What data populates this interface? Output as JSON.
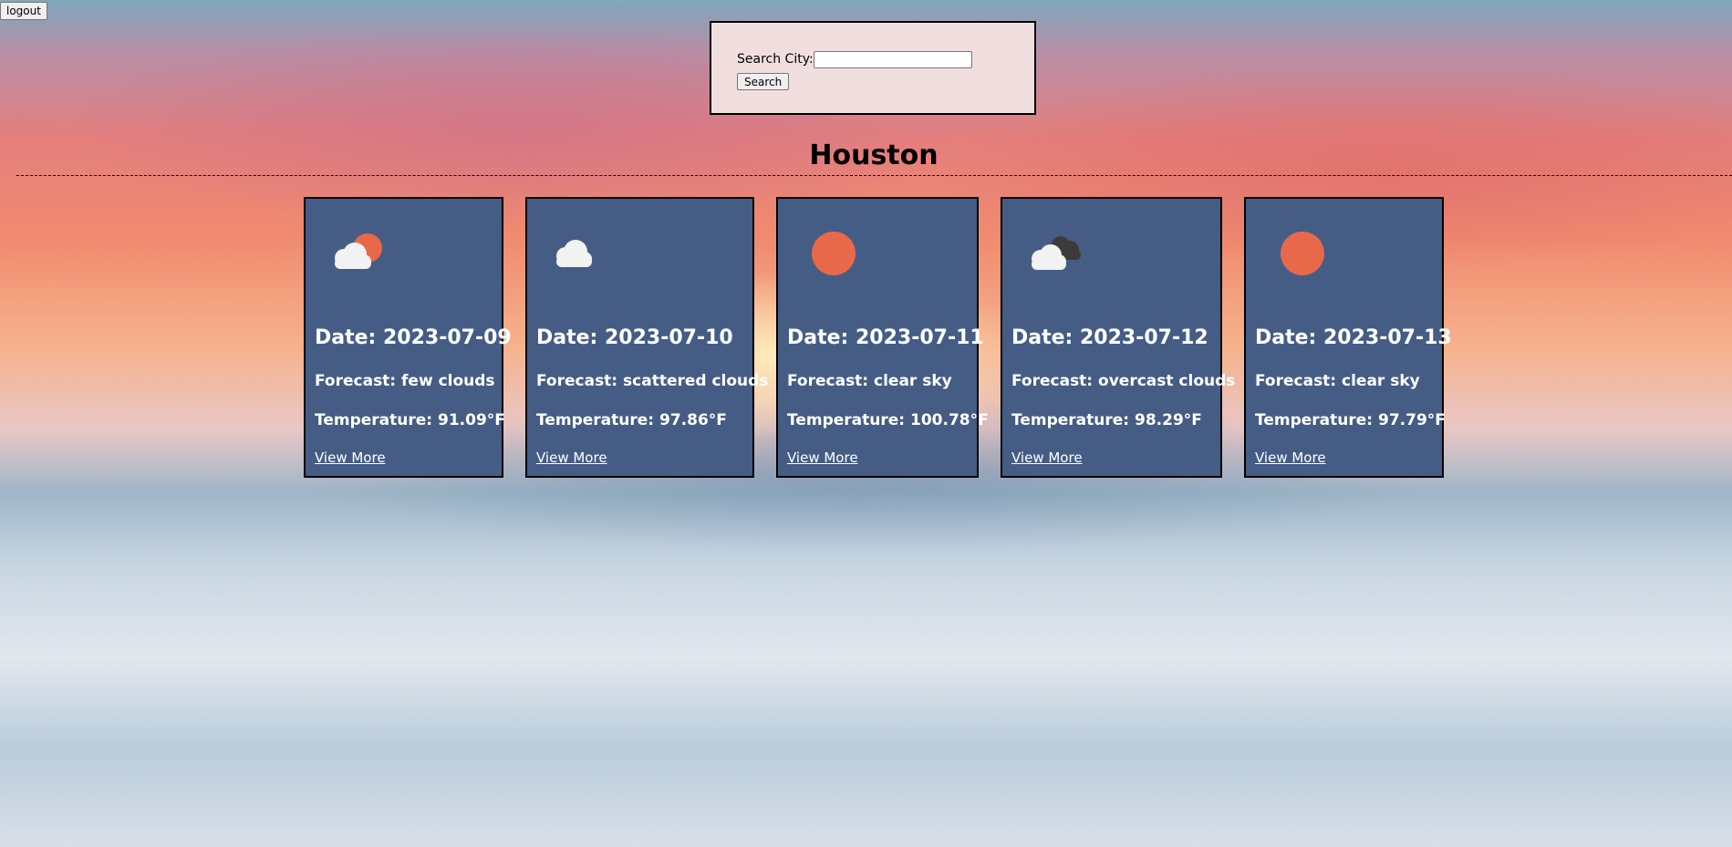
{
  "header": {
    "logout_label": "logout"
  },
  "search": {
    "label": "Search City:",
    "value": "",
    "placeholder": "",
    "button_label": "Search"
  },
  "city": "Houston",
  "forecasts": [
    {
      "date": "Date: 2023-07-09",
      "forecast": "Forecast: few clouds",
      "temperature": "Temperature: 91.09°F",
      "link": "View More",
      "icon": "few-clouds-icon"
    },
    {
      "date": "Date: 2023-07-10",
      "forecast": "Forecast: scattered clouds",
      "temperature": "Temperature: 97.86°F",
      "link": "View More",
      "icon": "scattered-clouds-icon"
    },
    {
      "date": "Date: 2023-07-11",
      "forecast": "Forecast: clear sky",
      "temperature": "Temperature: 100.78°F",
      "link": "View More",
      "icon": "clear-sky-icon"
    },
    {
      "date": "Date: 2023-07-12",
      "forecast": "Forecast: overcast clouds",
      "temperature": "Temperature: 98.29°F",
      "link": "View More",
      "icon": "overcast-clouds-icon"
    },
    {
      "date": "Date: 2023-07-13",
      "forecast": "Forecast: clear sky",
      "temperature": "Temperature: 97.79°F",
      "link": "View More",
      "icon": "clear-sky-icon"
    }
  ],
  "colors": {
    "card_background": "#455d85",
    "search_box_background": "#f1dfdf",
    "sun": "#e8694a",
    "cloud": "#f2f2f2",
    "dark_cloud": "#3b3b3b"
  }
}
